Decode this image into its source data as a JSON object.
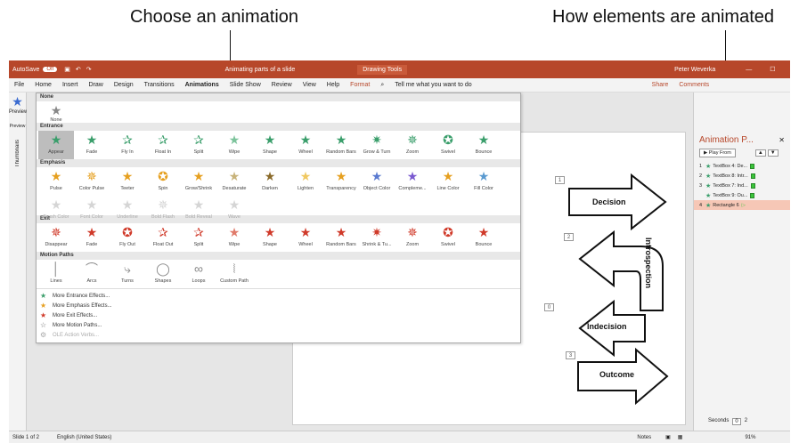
{
  "annotations": {
    "left": "Choose an animation",
    "right": "How elements are animated"
  },
  "titlebar": {
    "autosave": "AutoSave",
    "autosave_state": "Off",
    "doc_title": "Animating parts of a slide",
    "context_tab": "Drawing Tools",
    "user": "Peter Weverka"
  },
  "ribbon": {
    "tabs": [
      "File",
      "Home",
      "Insert",
      "Draw",
      "Design",
      "Transitions",
      "Animations",
      "Slide Show",
      "Review",
      "View",
      "Help",
      "Format"
    ],
    "tell_me": "Tell me what you want to do",
    "share": "Share",
    "comments": "Comments",
    "preview": "Preview",
    "preview_group": "Preview"
  },
  "left_panel": {
    "thumbnails": "Thumbnails"
  },
  "gallery": {
    "none_header": "None",
    "none_item": "None",
    "entrance_header": "Entrance",
    "entrance": [
      {
        "label": "Appear",
        "icon": "★",
        "color": "#3a9e6b"
      },
      {
        "label": "Fade",
        "icon": "★",
        "color": "#3a9e6b"
      },
      {
        "label": "Fly In",
        "icon": "✰",
        "color": "#3a9e6b"
      },
      {
        "label": "Float In",
        "icon": "✰",
        "color": "#3a9e6b"
      },
      {
        "label": "Split",
        "icon": "✰",
        "color": "#3a9e6b"
      },
      {
        "label": "Wipe",
        "icon": "★",
        "color": "#7cc39b"
      },
      {
        "label": "Shape",
        "icon": "★",
        "color": "#3a9e6b"
      },
      {
        "label": "Wheel",
        "icon": "★",
        "color": "#3a9e6b"
      },
      {
        "label": "Random Bars",
        "icon": "★",
        "color": "#3a9e6b"
      },
      {
        "label": "Grow & Turn",
        "icon": "✷",
        "color": "#3a9e6b"
      },
      {
        "label": "Zoom",
        "icon": "✵",
        "color": "#3a9e6b"
      },
      {
        "label": "Swivel",
        "icon": "✪",
        "color": "#3a9e6b"
      },
      {
        "label": "Bounce",
        "icon": "★",
        "color": "#3a9e6b"
      }
    ],
    "emphasis_header": "Emphasis",
    "emphasis": [
      {
        "label": "Pulse",
        "icon": "★",
        "color": "#e6a020"
      },
      {
        "label": "Color Pulse",
        "icon": "✵",
        "color": "#e6a020"
      },
      {
        "label": "Teeter",
        "icon": "★",
        "color": "#e6a020"
      },
      {
        "label": "Spin",
        "icon": "✪",
        "color": "#e6a020"
      },
      {
        "label": "Grow/Shrink",
        "icon": "★",
        "color": "#e6a020"
      },
      {
        "label": "Desaturate",
        "icon": "★",
        "color": "#c8b37a"
      },
      {
        "label": "Darken",
        "icon": "★",
        "color": "#8a6a2a"
      },
      {
        "label": "Lighten",
        "icon": "★",
        "color": "#f0c860"
      },
      {
        "label": "Transparency",
        "icon": "★",
        "color": "#e6a020"
      },
      {
        "label": "Object Color",
        "icon": "★",
        "color": "#5a7ad0"
      },
      {
        "label": "Compleme...",
        "icon": "★",
        "color": "#7a5ad0"
      },
      {
        "label": "Line Color",
        "icon": "★",
        "color": "#e6a020"
      },
      {
        "label": "Fill Color",
        "icon": "★",
        "color": "#5a9ad0"
      }
    ],
    "emphasis_disabled": [
      {
        "label": "Brush Color",
        "icon": "★"
      },
      {
        "label": "Font Color",
        "icon": "★"
      },
      {
        "label": "Underline",
        "icon": "★"
      },
      {
        "label": "Bold Flash",
        "icon": "✵"
      },
      {
        "label": "Bold Reveal",
        "icon": "★"
      },
      {
        "label": "Wave",
        "icon": "★"
      }
    ],
    "exit_header": "Exit",
    "exit": [
      {
        "label": "Disappear",
        "icon": "✵",
        "color": "#d03a2a"
      },
      {
        "label": "Fade",
        "icon": "★",
        "color": "#d03a2a"
      },
      {
        "label": "Fly Out",
        "icon": "✪",
        "color": "#d03a2a"
      },
      {
        "label": "Float Out",
        "icon": "✰",
        "color": "#d03a2a"
      },
      {
        "label": "Split",
        "icon": "✰",
        "color": "#d03a2a"
      },
      {
        "label": "Wipe",
        "icon": "★",
        "color": "#e07a6a"
      },
      {
        "label": "Shape",
        "icon": "★",
        "color": "#d03a2a"
      },
      {
        "label": "Wheel",
        "icon": "★",
        "color": "#d03a2a"
      },
      {
        "label": "Random Bars",
        "icon": "★",
        "color": "#d03a2a"
      },
      {
        "label": "Shrink & Tu...",
        "icon": "✷",
        "color": "#d03a2a"
      },
      {
        "label": "Zoom",
        "icon": "✵",
        "color": "#d03a2a"
      },
      {
        "label": "Swivel",
        "icon": "✪",
        "color": "#d03a2a"
      },
      {
        "label": "Bounce",
        "icon": "★",
        "color": "#d03a2a"
      }
    ],
    "motion_header": "Motion Paths",
    "motion": [
      {
        "label": "Lines",
        "icon": "│"
      },
      {
        "label": "Arcs",
        "icon": "⌒"
      },
      {
        "label": "Turns",
        "icon": "⤷"
      },
      {
        "label": "Shapes",
        "icon": "◯"
      },
      {
        "label": "Loops",
        "icon": "∞"
      },
      {
        "label": "Custom Path",
        "icon": "⦚"
      }
    ],
    "more": [
      {
        "label": "More Entrance Effects...",
        "icon": "★",
        "color": "#3a9e6b",
        "disabled": false
      },
      {
        "label": "More Emphasis Effects...",
        "icon": "★",
        "color": "#e6a020",
        "disabled": false
      },
      {
        "label": "More Exit Effects...",
        "icon": "★",
        "color": "#d03a2a",
        "disabled": false
      },
      {
        "label": "More Motion Paths...",
        "icon": "☆",
        "color": "#666666",
        "disabled": false
      },
      {
        "label": "OLE Action Verbs...",
        "icon": "⚙",
        "color": "#aaaaaa",
        "disabled": true
      }
    ]
  },
  "slide": {
    "decision": "Decision",
    "introspection": "Introspection",
    "indecision": "Indecision",
    "outcome": "Outcome",
    "tags": [
      "1",
      "2",
      "0",
      "3"
    ]
  },
  "anim_pane": {
    "title": "Animation P...",
    "play_from": "Play From",
    "items": [
      {
        "num": "1",
        "label": "TextBox 4: De...",
        "selected": false
      },
      {
        "num": "2",
        "label": "TextBox 8: Intr...",
        "selected": false
      },
      {
        "num": "3",
        "label": "TextBox 7: Ind...",
        "selected": false
      },
      {
        "num": "",
        "label": "TextBox 9: Ou...",
        "selected": false
      },
      {
        "num": "4",
        "label": "Rectangle 6",
        "selected": true
      }
    ],
    "seconds": "Seconds",
    "seconds_value": "0",
    "seconds_max": "2"
  },
  "status": {
    "slide": "Slide 1 of 2",
    "language": "English (United States)",
    "notes": "Notes",
    "zoom": "91%"
  },
  "colors": {
    "accent": "#b7472a",
    "entrance": "#3a9e6b",
    "emphasis": "#e6a020",
    "exit": "#d03a2a"
  }
}
